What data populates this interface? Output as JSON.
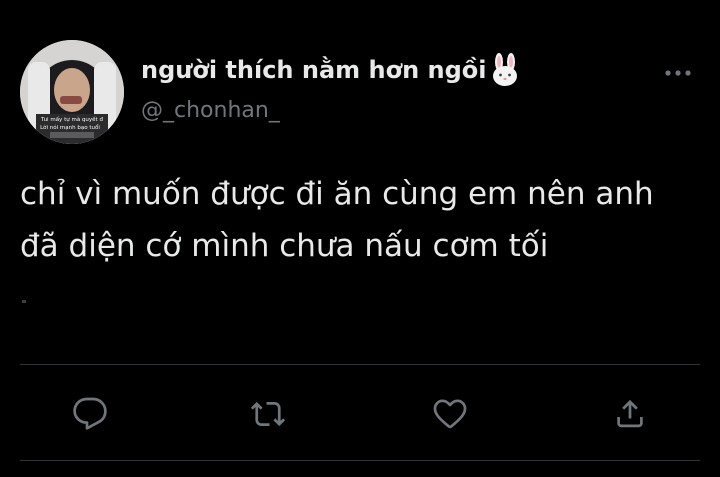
{
  "author": {
    "display_name": "người thích nằm hơn ngồi",
    "name_emoji": "rabbit-face-emoji",
    "handle": "@_chonhan_",
    "avatar_caption_lines": [
      "Tui mấy tự mà quyết đ",
      "Lời nói mạnh bạo tuổi"
    ]
  },
  "tweet": {
    "lines": [
      "chỉ vì muốn được đi ăn cùng em nên anh",
      "đã diện cớ mình chưa nấu cơm tối"
    ]
  },
  "actions": {
    "reply_icon": "reply-icon",
    "retweet_icon": "retweet-icon",
    "like_icon": "heart-icon",
    "share_icon": "share-icon"
  },
  "colors": {
    "background": "#000000",
    "text": "#e7e9ea",
    "secondary_text": "#71767b",
    "icon": "#71767b",
    "divider": "#2f3336"
  }
}
